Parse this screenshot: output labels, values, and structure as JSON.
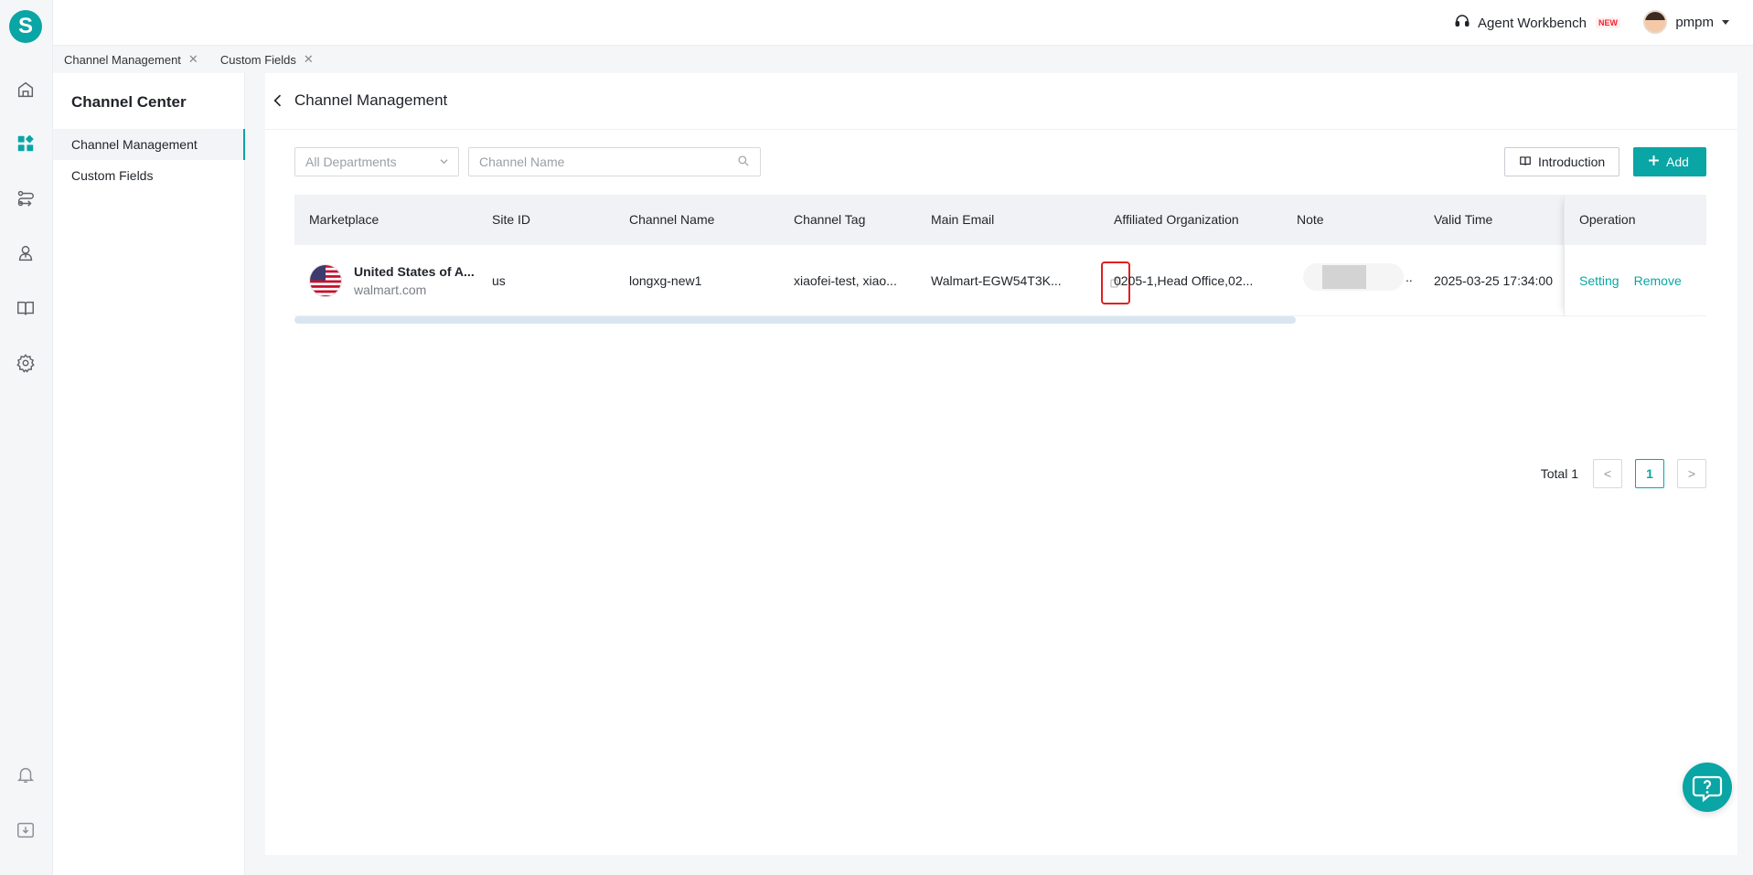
{
  "app": {
    "logo_letter": "S",
    "brand_color": "#0aa5a5"
  },
  "rail": {
    "icons": [
      "home-icon",
      "dashboard-icon",
      "route-icon",
      "user-icon",
      "book-icon",
      "gear-icon",
      "bell-icon",
      "download-icon"
    ],
    "active": "dashboard-icon"
  },
  "topbar": {
    "workbench_label": "Agent Workbench",
    "workbench_badge": "NEW",
    "username": "pmpm"
  },
  "tabs": [
    {
      "label": "Channel Management"
    },
    {
      "label": "Custom Fields"
    }
  ],
  "subside": {
    "title": "Channel Center",
    "items": [
      {
        "label": "Channel Management",
        "active": true
      },
      {
        "label": "Custom Fields",
        "active": false
      }
    ]
  },
  "main": {
    "title": "Channel Management",
    "department_select": "All Departments",
    "search_placeholder": "Channel Name",
    "intro_label": "Introduction",
    "add_label": "Add"
  },
  "table": {
    "columns": [
      "Marketplace",
      "Site ID",
      "Channel Name",
      "Channel Tag",
      "Main Email",
      "Affiliated Organization",
      "Note",
      "Valid Time",
      "Operation"
    ],
    "rows": [
      {
        "marketplace_name": "United States of A...",
        "marketplace_site": "walmart.com",
        "site_id": "us",
        "channel_name": "longxg-new1",
        "channel_tag": "xiaofei-test, xiao...",
        "main_email": "Walmart-EGW54T3K...",
        "affiliated_org": "0205-1,Head Office,02...",
        "note": "..",
        "valid_time": "2025-03-25 17:34:00",
        "op_setting": "Setting",
        "op_remove": "Remove"
      }
    ]
  },
  "pagination": {
    "total_label": "Total 1",
    "current_page": "1",
    "prev": "<",
    "next": ">"
  }
}
